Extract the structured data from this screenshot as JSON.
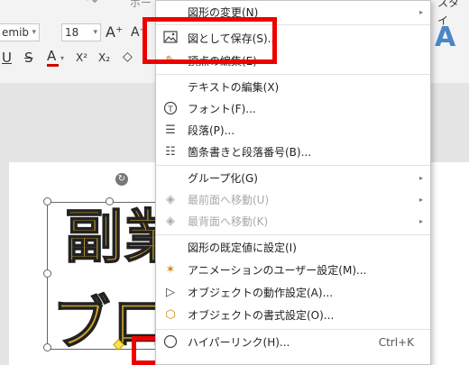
{
  "ribbon": {
    "font_name": "emib",
    "font_size": "18",
    "grow_font": "A⁺",
    "shrink_font": "A⁻",
    "underline": "U",
    "strike": "S",
    "font_color": "A",
    "superscript": "X²",
    "subscript": "X₂",
    "clear_format": "◇",
    "cut_tab": "ポー",
    "style_tab": "スタイ",
    "style_letter": "A"
  },
  "slide": {
    "line1": "副業",
    "line2": "ブロ"
  },
  "menu": {
    "items": [
      {
        "label": "図形の変更(N)",
        "icon": "shape-icon",
        "submenu": true,
        "enabled": true
      },
      {
        "label": "図として保存(S)...",
        "icon": "picture-icon",
        "submenu": false,
        "enabled": true
      },
      {
        "label": "頂点の編集(E)",
        "icon": "edit-points-icon",
        "submenu": false,
        "enabled": true
      },
      {
        "label": "テキストの編集(X)",
        "icon": "",
        "submenu": false,
        "enabled": true
      },
      {
        "label": "フォント(F)...",
        "icon": "font-icon",
        "submenu": false,
        "enabled": true
      },
      {
        "label": "段落(P)...",
        "icon": "paragraph-icon",
        "submenu": false,
        "enabled": true
      },
      {
        "label": "箇条書きと段落番号(B)...",
        "icon": "bullets-icon",
        "submenu": false,
        "enabled": true
      },
      {
        "label": "グループ化(G)",
        "icon": "",
        "submenu": true,
        "enabled": true
      },
      {
        "label": "最前面へ移動(U)",
        "icon": "bring-front-icon",
        "submenu": true,
        "enabled": false
      },
      {
        "label": "最背面へ移動(K)",
        "icon": "send-back-icon",
        "submenu": true,
        "enabled": false
      },
      {
        "label": "図形の既定値に設定(I)",
        "icon": "",
        "submenu": false,
        "enabled": true
      },
      {
        "label": "アニメーションのユーザー設定(M)...",
        "icon": "animation-icon",
        "submenu": false,
        "enabled": true
      },
      {
        "label": "オブジェクトの動作設定(A)...",
        "icon": "action-icon",
        "submenu": false,
        "enabled": true
      },
      {
        "label": "オブジェクトの書式設定(O)...",
        "icon": "format-icon",
        "submenu": false,
        "enabled": true
      },
      {
        "label": "ハイパーリンク(H)...",
        "icon": "hyperlink-icon",
        "submenu": false,
        "enabled": true,
        "shortcut": "Ctrl+K"
      }
    ]
  },
  "colors": {
    "highlight": "#ee0000",
    "font_color_bar": "#d00000",
    "style_blue": "#4a86c8",
    "gold": "#c9a227"
  }
}
